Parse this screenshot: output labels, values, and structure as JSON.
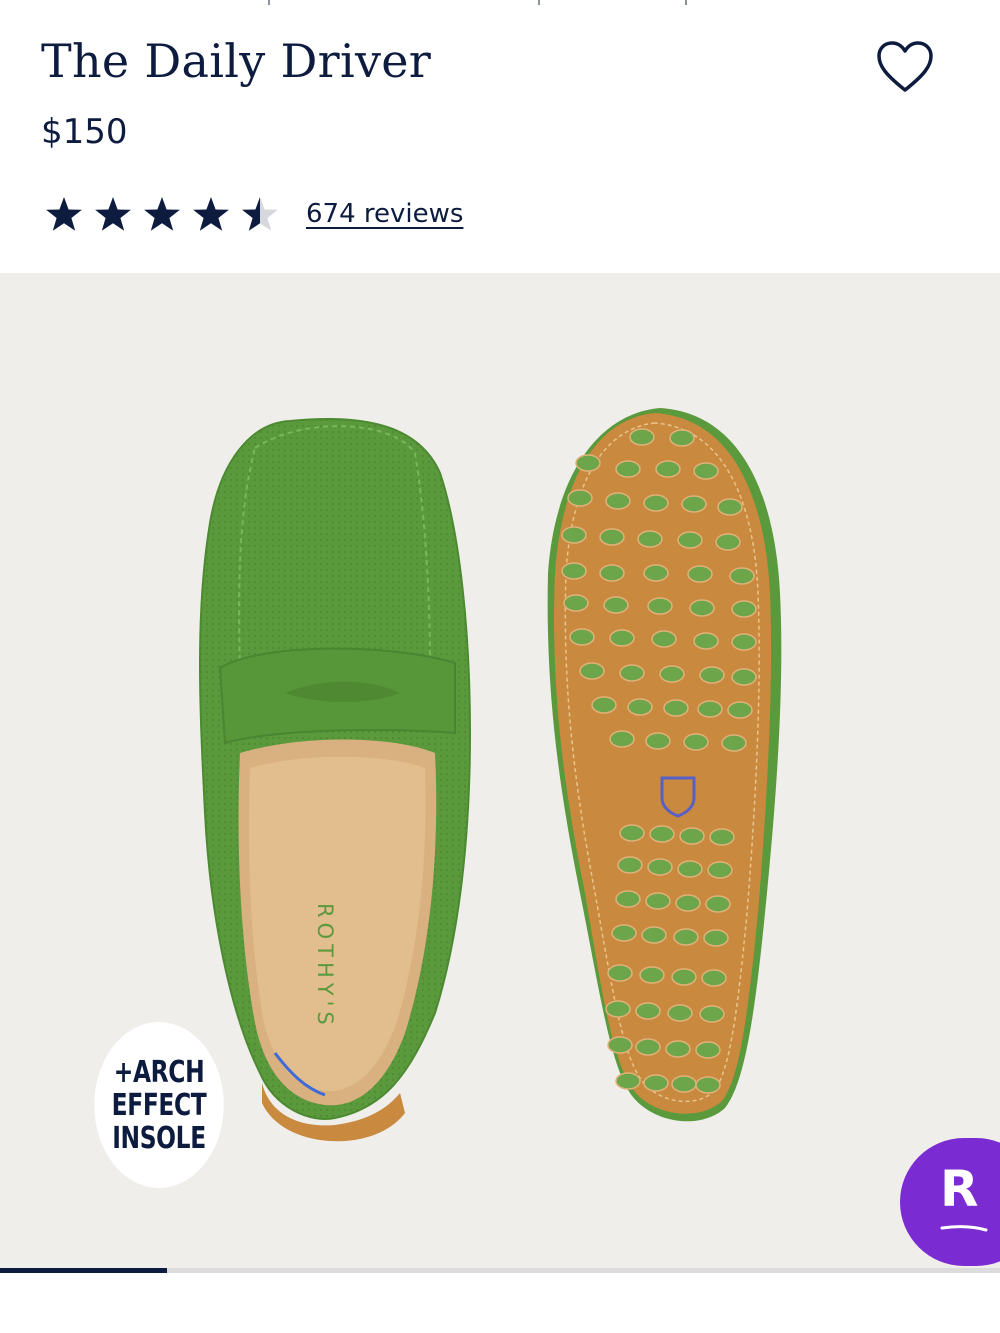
{
  "product": {
    "title": "The Daily Driver",
    "price": "$150",
    "rating": 4.5,
    "reviews_label": "674 reviews"
  },
  "icons": {
    "favorite": "heart-outline-icon",
    "rating_star": "star-icon",
    "chat": "rakuten-r-icon"
  },
  "hero": {
    "badge_lines": [
      "+ARCH",
      "EFFECT",
      "INSOLE"
    ],
    "insole_brand": "ROTHY'S",
    "shoe_color": "#5a9a3c",
    "sole_color": "#c9893f"
  },
  "rakuten_button": {
    "letter": "R",
    "color": "#7a2bd1"
  },
  "gallery": {
    "progress": 0.1667
  },
  "colors": {
    "navy": "#0d1b3e",
    "background": "#efeeeb"
  }
}
